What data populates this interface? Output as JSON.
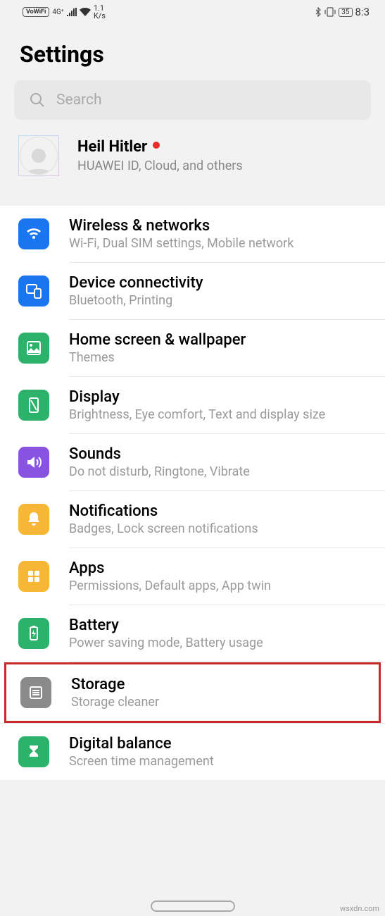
{
  "status": {
    "vowifi": "VoWiFi",
    "net_top": "1.1",
    "net_bot": "K/s",
    "battery": "35",
    "time": "8:3"
  },
  "page_title": "Settings",
  "search": {
    "placeholder": "Search"
  },
  "account": {
    "name": "Heil Hitler",
    "sub": "HUAWEI ID, Cloud, and others"
  },
  "items": [
    {
      "icon": "wifi-icon",
      "color": "c-blue",
      "title": "Wireless & networks",
      "sub": "Wi-Fi, Dual SIM settings, Mobile network"
    },
    {
      "icon": "device-icon",
      "color": "c-blue2",
      "title": "Device connectivity",
      "sub": "Bluetooth, Printing"
    },
    {
      "icon": "wallpaper-icon",
      "color": "c-green",
      "title": "Home screen & wallpaper",
      "sub": "Themes"
    },
    {
      "icon": "display-icon",
      "color": "c-green",
      "title": "Display",
      "sub": "Brightness, Eye comfort, Text and display size"
    },
    {
      "icon": "sound-icon",
      "color": "c-purple",
      "title": "Sounds",
      "sub": "Do not disturb, Ringtone, Vibrate"
    },
    {
      "icon": "bell-icon",
      "color": "c-orange",
      "title": "Notifications",
      "sub": "Badges, Lock screen notifications"
    },
    {
      "icon": "apps-icon",
      "color": "c-orange",
      "title": "Apps",
      "sub": "Permissions, Default apps, App twin"
    },
    {
      "icon": "battery-icon",
      "color": "c-green",
      "title": "Battery",
      "sub": "Power saving mode, Battery usage"
    },
    {
      "icon": "storage-icon",
      "color": "c-grey",
      "title": "Storage",
      "sub": "Storage cleaner",
      "highlight": true
    },
    {
      "icon": "hourglass-icon",
      "color": "c-green",
      "title": "Digital balance",
      "sub": "Screen time management"
    }
  ],
  "watermark": "wsxdn.com"
}
